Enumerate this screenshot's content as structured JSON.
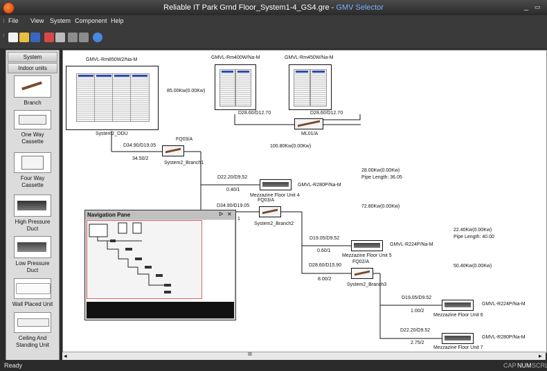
{
  "window": {
    "doc_title": "Reliable IT Park Grnd Floor_System1-4_GS4.gre",
    "separator": " - ",
    "app_name": "GMV Selector",
    "min_glyph": "_",
    "close_glyph": "▭"
  },
  "menu": [
    "File",
    "View",
    "System",
    "Component",
    "Help"
  ],
  "toolbar_icons": [
    "new-icon",
    "open-icon",
    "save-icon",
    "print-icon",
    "copy-icon",
    "undo-icon",
    "redo-icon",
    "help-icon"
  ],
  "sidebar": {
    "tabs": [
      "System",
      "Indoor units"
    ],
    "components": [
      {
        "label": "Branch",
        "icon": "branch-icon"
      },
      {
        "label": "One Way\nCassette",
        "icon": "one-way-cassette-icon"
      },
      {
        "label": "Four Way\nCassette",
        "icon": "four-way-cassette-icon"
      },
      {
        "label": "High Pressure\nDuct",
        "icon": "high-pressure-duct-icon"
      },
      {
        "label": "Low Pressure\nDuct",
        "icon": "low-pressure-duct-icon"
      },
      {
        "label": "Wall Placed Unit",
        "icon": "wall-unit-icon"
      },
      {
        "label": "Ceiling And\nStanding Unit",
        "icon": "ceiling-standing-icon"
      }
    ]
  },
  "diagram": {
    "odu_main_model": "GMVL-Rm850W2/Na-M",
    "odu_main_name": "System2_ODU",
    "odu_mod1_model": "GMVL-Rm400W/Na-M",
    "odu_mod2_model": "GMVL-Rm450W/Na-M",
    "odu_mod1_pipe": "D28.60/D12.70",
    "odu_mod2_pipe": "D28.60/D12.70",
    "ml01": "ML01/A",
    "capacity_main": "85.00Kw(0.00Kw)",
    "capacity_total": "100.80Kw(0.00Kw)",
    "pipe_odu": "D34.90/D19.05",
    "len_odu": "34.50/2",
    "fq_branch1": "FQ03/A",
    "branch1_name": "System2_Branch1",
    "pipe_unit4": "D22.20/D9.52",
    "len_unit4": "0.40/1",
    "unit4_model": "GMVL-R280P/Na-M",
    "unit4_name": "Mezzazine Floor Unit 4",
    "cap_unit4": "28.00Kw(0.00Kw)",
    "plen_unit4": "Pipe Length: 36.05",
    "pipe_branch2": "D34.90/D19.05",
    "fq_branch2": "FQ03/A",
    "branch2_name": "System2_Branch2",
    "cap_branch2": "72.80Kw(0.00Kw)",
    "pipe_unit5": "D19.05/D9.52",
    "len_unit5": "0.60/1",
    "unit5_model": "GMVL-R224P/Na-M",
    "unit5_name": "Mezzazine Floor Unit 5",
    "cap_unit5": "22.40Kw(0.00Kw)",
    "plen_unit5": "Pipe Length: 40.00",
    "pipe_branch3": "D28.60/D15.90",
    "fq_branch3": "FQ02/A",
    "len_branch3": "8.00/2",
    "branch3_name": "System2_Branch3",
    "cap_branch3": "50.40Kw(0.00Kw)",
    "pipe_unit6": "D19.05/D9.52",
    "len_unit6": "1.00/2",
    "unit6_model": "GMVL-R224P/Na-M",
    "unit6_name": "Mezzazine Floor Unit 6",
    "pipe_unit7": "D22.20/D9.52",
    "len_unit7": "2.75/2",
    "unit7_model": "GMVL-R280P/Na-M",
    "unit7_name": "Mezzazine Floor Unit 7",
    "stray_1": "1"
  },
  "nav_pane": {
    "title": "Navigation Pane",
    "pin": "ᐅ",
    "close": "✕"
  },
  "scrollbar": {
    "left": "◂",
    "right": "▸",
    "thumb": "III"
  },
  "status": {
    "text": "Ready",
    "cap": "CAP",
    "num": "NUM",
    "scrl": "SCRL"
  },
  "colors": {
    "title_accent": "#7fb2ff",
    "nav_frame": "#e06060",
    "pipe": "#111111"
  }
}
